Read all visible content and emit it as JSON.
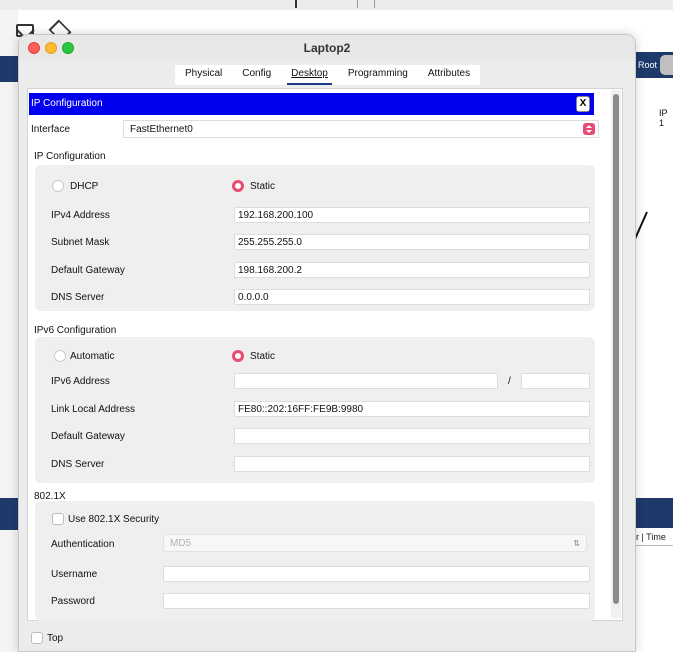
{
  "window": {
    "title": "Laptop2"
  },
  "tabs": [
    "Physical",
    "Config",
    "Desktop",
    "Programming",
    "Attributes"
  ],
  "active_tab": "Desktop",
  "ip_config_header": {
    "title": "IP Configuration",
    "close_label": "X"
  },
  "interface": {
    "label": "Interface",
    "value": "FastEthernet0"
  },
  "ipv4": {
    "section_title": "IP Configuration",
    "dhcp_label": "DHCP",
    "static_label": "Static",
    "selected_mode": "Static",
    "fields": [
      {
        "label": "IPv4 Address",
        "value": "192.168.200.100"
      },
      {
        "label": "Subnet Mask",
        "value": "255.255.255.0"
      },
      {
        "label": "Default Gateway",
        "value": "198.168.200.2"
      },
      {
        "label": "DNS Server",
        "value": "0.0.0.0"
      }
    ]
  },
  "ipv6": {
    "section_title": "IPv6 Configuration",
    "automatic_label": "Automatic",
    "static_label": "Static",
    "selected_mode": "Static",
    "address_label": "IPv6 Address",
    "address_value": "",
    "prefix_separator": "/",
    "prefix_value": "",
    "fields": [
      {
        "label": "Link Local Address",
        "value": "FE80::202:16FF:FE9B:9980"
      },
      {
        "label": "Default Gateway",
        "value": ""
      },
      {
        "label": "DNS Server",
        "value": ""
      }
    ]
  },
  "dot1x": {
    "section_title": "802.1X",
    "use_label": "Use 802.1X Security",
    "use_checked": false,
    "auth_label": "Authentication",
    "auth_value": "MD5",
    "username_label": "Username",
    "username_value": "",
    "password_label": "Password",
    "password_value": ""
  },
  "bottom": {
    "top_label": "Top",
    "top_checked": false
  },
  "background": {
    "root_label": "Root",
    "ip_label": "IP 1",
    "time_label": "r | Time"
  },
  "colors": {
    "header_blue": "#0000ee",
    "accent_pink": "#e84a72",
    "tab_underline": "#1b3a8a",
    "bg_dark_blue": "#1e3a6b"
  }
}
